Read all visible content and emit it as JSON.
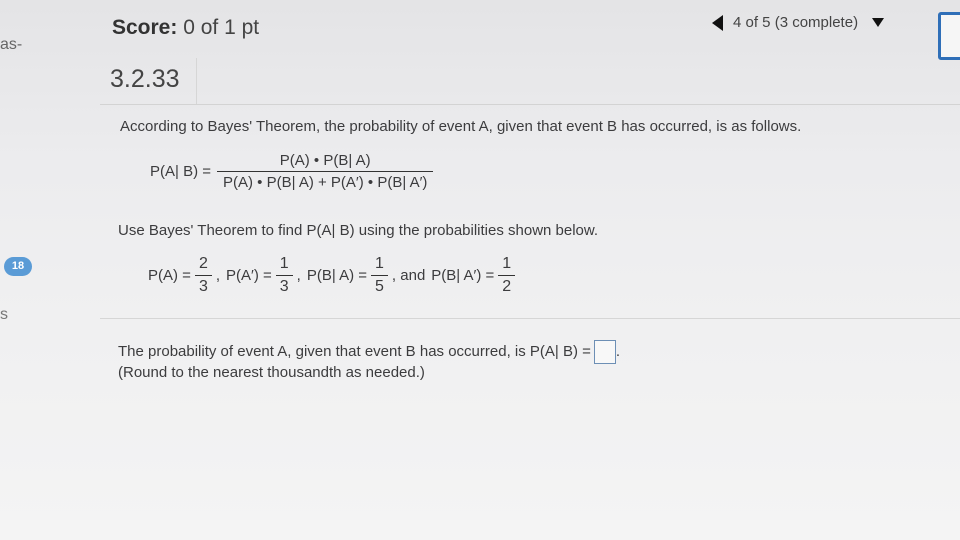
{
  "header": {
    "score_label": "Score:",
    "score_value": "0 of 1 pt",
    "question_nav": "4 of 5 (3 complete)"
  },
  "left_edge": {
    "fragment_top": "as-",
    "badge": "18",
    "fragment_mid": "s"
  },
  "question": {
    "number": "3.2.33",
    "intro": "According to Bayes' Theorem, the probability of event A, given that event B has occurred, is as follows.",
    "formula": {
      "lhs": "P(A| B) =",
      "numerator": "P(A) • P(B| A)",
      "denominator": "P(A) • P(B| A) + P(A′) • P(B| A′)"
    },
    "instruction": "Use Bayes' Theorem to find P(A| B) using the probabilities shown below.",
    "given": {
      "pa_label": "P(A) =",
      "pa_num": "2",
      "pa_den": "3",
      "sep1": ",",
      "pac_label": "P(A′) =",
      "pac_num": "1",
      "pac_den": "3",
      "sep2": ",",
      "pba_label": "P(B| A) =",
      "pba_num": "1",
      "pba_den": "5",
      "sep3": ", and",
      "pbac_label": "P(B| A′) =",
      "pbac_num": "1",
      "pbac_den": "2"
    },
    "answer_prompt": "The probability of event A, given that event B has occurred, is P(A| B) =",
    "answer_value": "",
    "answer_suffix": ".",
    "round_note": "(Round to the nearest thousandth as needed.)"
  }
}
